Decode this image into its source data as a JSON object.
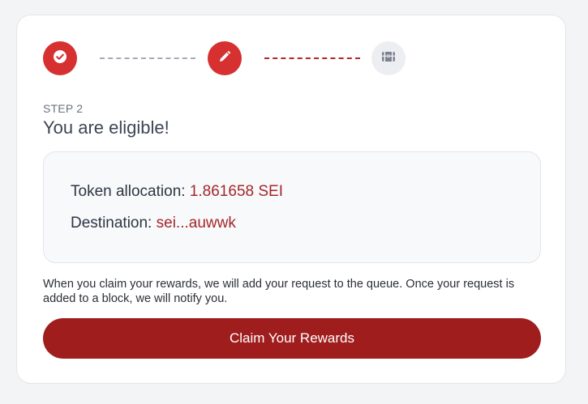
{
  "stepper": {
    "steps": [
      {
        "icon": "check-circle-icon",
        "state": "completed"
      },
      {
        "icon": "pencil-icon",
        "state": "current"
      },
      {
        "icon": "treasure-chest-icon",
        "state": "upcoming"
      }
    ]
  },
  "step": {
    "label": "STEP 2",
    "title": "You are eligible!"
  },
  "allocation": {
    "token_label": "Token allocation:",
    "token_value": "1.861658 SEI",
    "destination_label": "Destination:",
    "destination_value": "sei...auwwk"
  },
  "description": "When you claim your rewards, we will add your request to the queue. Once your request is added to a block, we will notify you.",
  "actions": {
    "claim_label": "Claim Your Rewards"
  },
  "colors": {
    "accent": "#d63031",
    "button": "#a01d1d",
    "value_text": "#a3282a",
    "page_background": "#f3f4f6"
  }
}
